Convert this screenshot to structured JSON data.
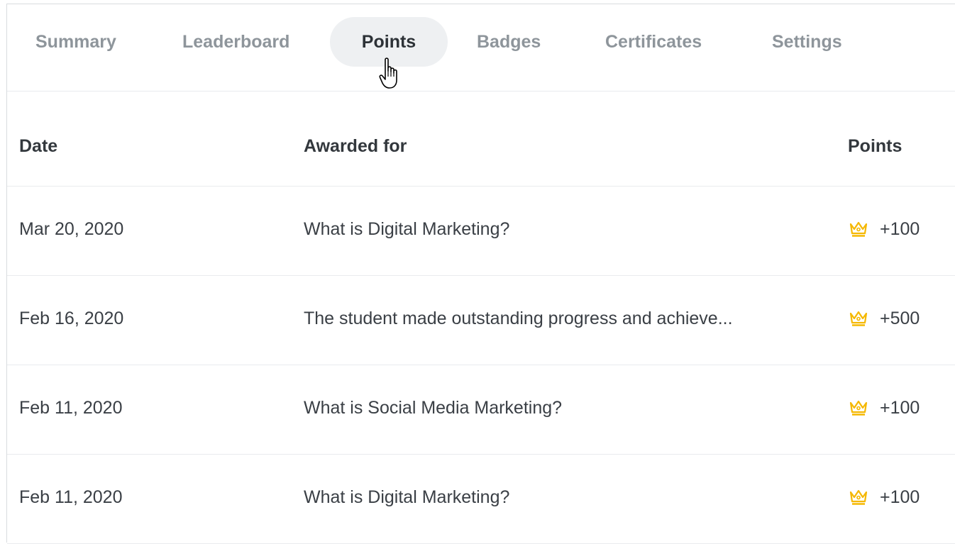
{
  "tabs": [
    {
      "label": "Summary",
      "active": false
    },
    {
      "label": "Leaderboard",
      "active": false
    },
    {
      "label": "Points",
      "active": true
    },
    {
      "label": "Badges",
      "active": false
    },
    {
      "label": "Certificates",
      "active": false
    },
    {
      "label": "Settings",
      "active": false
    }
  ],
  "table": {
    "headers": {
      "date": "Date",
      "awarded_for": "Awarded for",
      "points": "Points"
    },
    "rows": [
      {
        "date": "Mar 20, 2020",
        "awarded_for": "What is Digital Marketing?",
        "points": "+100",
        "icon": "crown-icon"
      },
      {
        "date": "Feb 16, 2020",
        "awarded_for": "The student made outstanding progress and achieve...",
        "points": "+500",
        "icon": "crown-icon"
      },
      {
        "date": "Feb 11, 2020",
        "awarded_for": "What is Social Media Marketing?",
        "points": "+100",
        "icon": "crown-icon"
      },
      {
        "date": "Feb 11, 2020",
        "awarded_for": "What is Digital Marketing?",
        "points": "+100",
        "icon": "crown-icon"
      }
    ]
  },
  "colors": {
    "accent_crown": "#f5b800",
    "active_tab_bg": "#eef0f2",
    "inactive_tab_text": "#8e959b"
  }
}
